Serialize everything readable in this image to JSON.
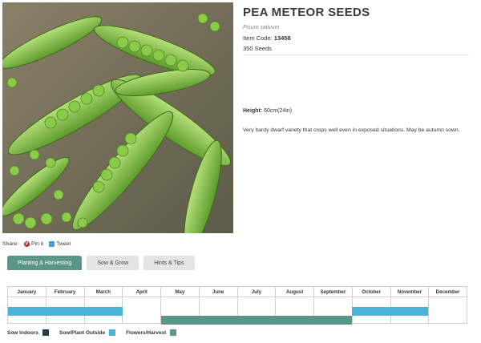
{
  "product": {
    "title": "PEA METEOR SEEDS",
    "latin": "Pisum sativum",
    "code_label": "Item Code:",
    "code_value": "13458",
    "seeds": "350 Seeds",
    "height_label": "Height:",
    "height_value": "60cm(24in)",
    "description": "Very hardy dwarf variety that crops well even in exposed situations. May be autumn sown."
  },
  "share": {
    "label": "Share:",
    "pin_label": "Pin it",
    "tweet_label": "Tweet"
  },
  "tabs": [
    {
      "label": "Planting & Harvesting",
      "active": true
    },
    {
      "label": "Sow & Grow",
      "active": false
    },
    {
      "label": "Hints & Tips",
      "active": false
    }
  ],
  "calendar": {
    "months": [
      "January",
      "February",
      "March",
      "April",
      "May",
      "June",
      "July",
      "August",
      "September",
      "October",
      "November",
      "December"
    ],
    "sow_outside_months": [
      [
        "January",
        "March"
      ],
      [
        "October",
        "November"
      ]
    ],
    "harvest_months": [
      [
        "May",
        "September"
      ]
    ]
  },
  "legend": [
    {
      "label": "Sow Indoors",
      "color": "#2c3e4c"
    },
    {
      "label": "Sow/Plant Outside",
      "color": "#4ab4d6"
    },
    {
      "label": "Flowers/Harvest",
      "color": "#5a9687"
    }
  ]
}
